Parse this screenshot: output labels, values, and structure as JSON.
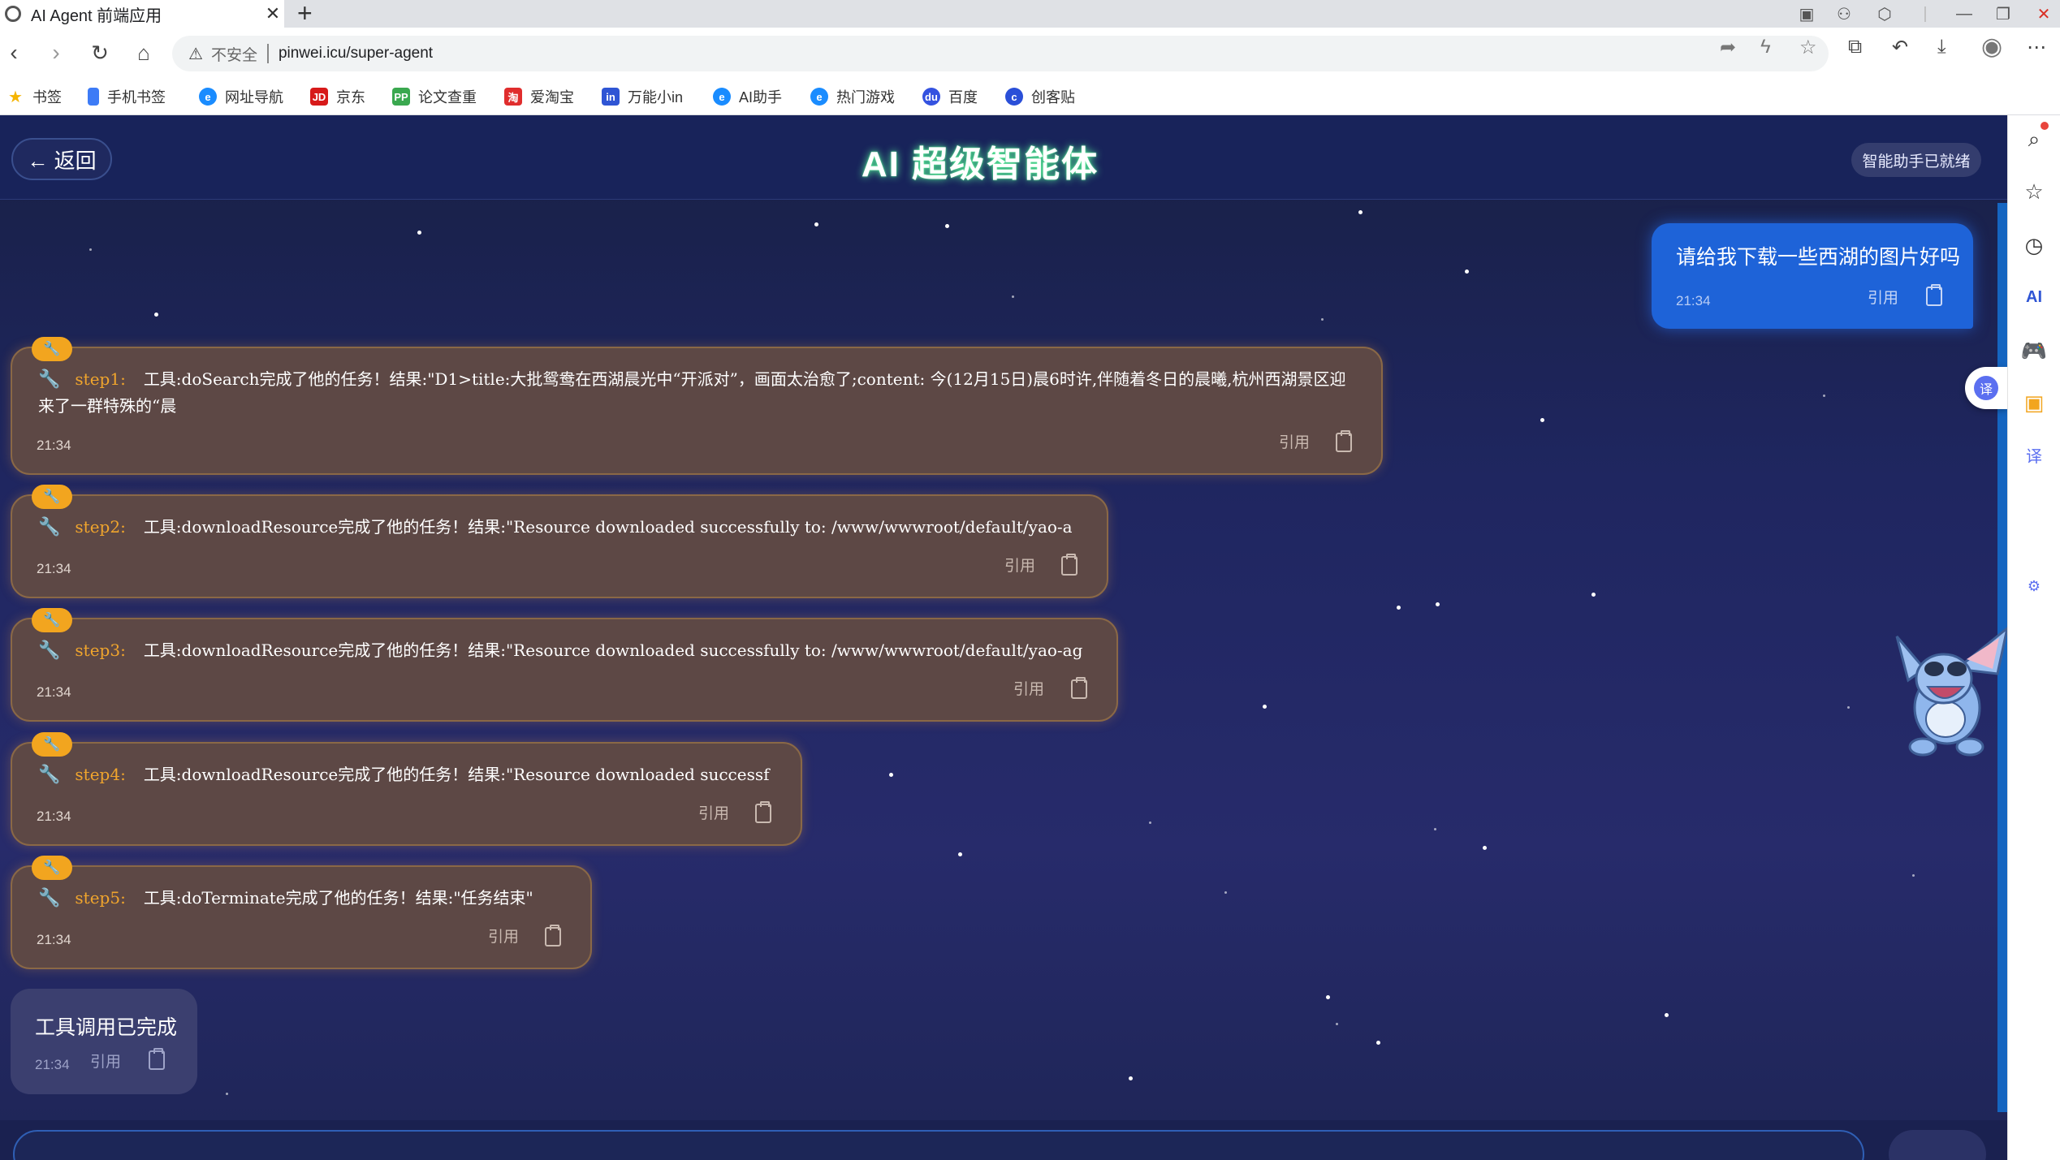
{
  "browser": {
    "tab_title": "AI Agent 前端应用",
    "tab_close": "✕",
    "new_tab": "+",
    "address": {
      "insecure_label": "不安全",
      "url": "pinwei.icu/super-agent"
    },
    "bookmarks": [
      {
        "label": "书签",
        "icon_color": "#f5b400",
        "glyph": "★"
      },
      {
        "label": "手机书签",
        "icon_color": "#3d7bf6",
        "glyph": ""
      },
      {
        "label": "网址导航",
        "icon_color": "#1a8cff",
        "glyph": "e"
      },
      {
        "label": "京东",
        "icon_color": "#d71a1a",
        "glyph": "JD"
      },
      {
        "label": "论文查重",
        "icon_color": "#3aa84f",
        "glyph": "PP"
      },
      {
        "label": "爱淘宝",
        "icon_color": "#e02d2d",
        "glyph": "淘"
      },
      {
        "label": "万能小in",
        "icon_color": "#2f55d4",
        "glyph": "in"
      },
      {
        "label": "AI助手",
        "icon_color": "#1a8cff",
        "glyph": "e"
      },
      {
        "label": "热门游戏",
        "icon_color": "#1a8cff",
        "glyph": "e"
      },
      {
        "label": "百度",
        "icon_color": "#3452e0",
        "glyph": "du"
      },
      {
        "label": "创客贴",
        "icon_color": "#2a4fd8",
        "glyph": "c"
      }
    ]
  },
  "app": {
    "back_label": "← 返回",
    "title": "AI 超级智能体",
    "status": "智能助手已就绪"
  },
  "messages": {
    "user": {
      "text": "请给我下载一些西湖的图片好吗",
      "time": "21:34",
      "cite_label": "引用"
    },
    "steps": [
      {
        "label": "step1:",
        "text": "工具:doSearch完成了他的任务！结果:\"D1>title:大批鸳鸯在西湖晨光中“开派对”，画面太治愈了;content: 今(12月15日)晨6时许,伴随着冬日的晨曦,杭州西湖景区迎来了一群特殊的“晨",
        "time": "21:34",
        "cite_label": "引用"
      },
      {
        "label": "step2:",
        "text": "工具:downloadResource完成了他的任务！结果:\"Resource downloaded successfully to: /www/wwwroot/default/yao-a",
        "time": "21:34",
        "cite_label": "引用"
      },
      {
        "label": "step3:",
        "text": "工具:downloadResource完成了他的任务！结果:\"Resource downloaded successfully to: /www/wwwroot/default/yao-ag",
        "time": "21:34",
        "cite_label": "引用"
      },
      {
        "label": "step4:",
        "text": "工具:downloadResource完成了他的任务！结果:\"Resource downloaded successf",
        "time": "21:34",
        "cite_label": "引用"
      },
      {
        "label": "step5:",
        "text": "工具:doTerminate完成了他的任务！结果:\"任务结束\"",
        "time": "21:34",
        "cite_label": "引用"
      }
    ],
    "done": {
      "text": "工具调用已完成",
      "time": "21:34",
      "cite_label": "引用"
    }
  },
  "icons": {
    "step_badge": "wrench-icon",
    "copy": "clipboard-icon"
  },
  "colors": {
    "accent_blue": "#1e63d8",
    "step_label": "#f0a52d",
    "title_glow": "#5cff9d"
  }
}
